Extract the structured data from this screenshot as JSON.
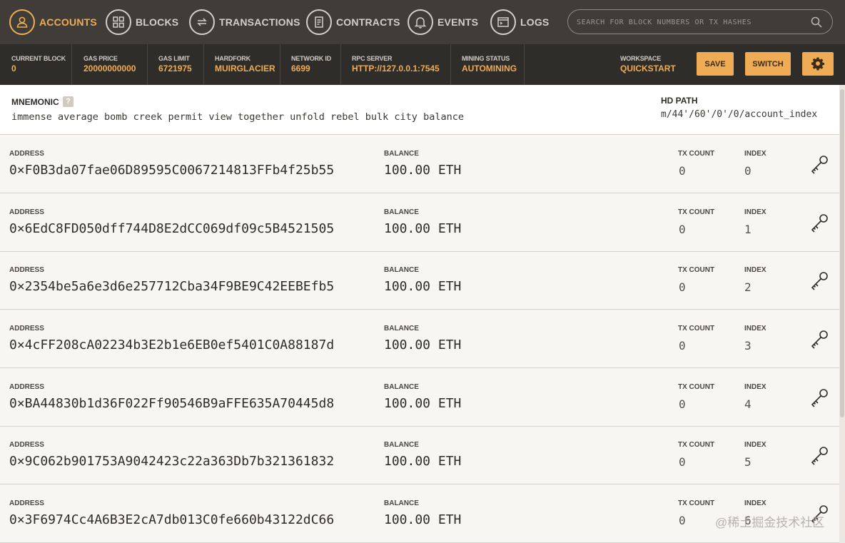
{
  "nav": {
    "accounts": "ACCOUNTS",
    "blocks": "BLOCKS",
    "transactions": "TRANSACTIONS",
    "contracts": "CONTRACTS",
    "events": "EVENTS",
    "logs": "LOGS",
    "active": "accounts",
    "search_placeholder": "SEARCH FOR BLOCK NUMBERS OR TX HASHES",
    "icons": [
      "user-icon",
      "blocks-icon",
      "transactions-icon",
      "contracts-icon",
      "bell-icon",
      "terminal-icon",
      "search-icon"
    ]
  },
  "status": {
    "current_block": {
      "label": "CURRENT BLOCK",
      "value": "0"
    },
    "gas_price": {
      "label": "GAS PRICE",
      "value": "20000000000"
    },
    "gas_limit": {
      "label": "GAS LIMIT",
      "value": "6721975"
    },
    "hardfork": {
      "label": "HARDFORK",
      "value": "MUIRGLACIER"
    },
    "network_id": {
      "label": "NETWORK ID",
      "value": "6699"
    },
    "rpc_server": {
      "label": "RPC SERVER",
      "value": "HTTP://127.0.0.1:7545"
    },
    "mining_status": {
      "label": "MINING STATUS",
      "value": "AUTOMINING"
    },
    "workspace": {
      "label": "WORKSPACE",
      "value": "QUICKSTART"
    },
    "save_label": "SAVE",
    "switch_label": "SWITCH"
  },
  "mnemonic": {
    "label": "MNEMONIC",
    "help": "?",
    "words": "immense average bomb creek permit view together unfold rebel bulk city balance",
    "hd_path_label": "HD PATH",
    "hd_path": "m/44'/60'/0'/0/account_index"
  },
  "account_labels": {
    "address": "ADDRESS",
    "balance": "BALANCE",
    "tx_count": "TX COUNT",
    "index": "INDEX"
  },
  "accounts": [
    {
      "address": "0×F0B3da07fae06D89595C0067214813FFb4f25b55",
      "balance": "100.00 ETH",
      "tx_count": "0",
      "index": "0"
    },
    {
      "address": "0×6EdC8FD050dff744D8E2dCC069df09c5B4521505",
      "balance": "100.00 ETH",
      "tx_count": "0",
      "index": "1"
    },
    {
      "address": "0×2354be5a6e3d6e257712Cba34F9BE9C42EEBEfb5",
      "balance": "100.00 ETH",
      "tx_count": "0",
      "index": "2"
    },
    {
      "address": "0×4cFF208cA02234b3E2b1e6EB0ef5401C0A88187d",
      "balance": "100.00 ETH",
      "tx_count": "0",
      "index": "3"
    },
    {
      "address": "0×BA44830b1d36F022Ff90546B9aFFE635A70445d8",
      "balance": "100.00 ETH",
      "tx_count": "0",
      "index": "4"
    },
    {
      "address": "0×9C062b901753A9042423c22a363Db7b321361832",
      "balance": "100.00 ETH",
      "tx_count": "0",
      "index": "5"
    },
    {
      "address": "0×3F6974Cc4A6B3E2cA7db013C0fe660b43122dC66",
      "balance": "100.00 ETH",
      "tx_count": "0",
      "index": "6"
    }
  ],
  "watermark": "@稀土掘金技术社区",
  "colors": {
    "accent": "#f0ac54",
    "nav_bg": "#403d39",
    "status_bg": "#2f2d2a"
  }
}
